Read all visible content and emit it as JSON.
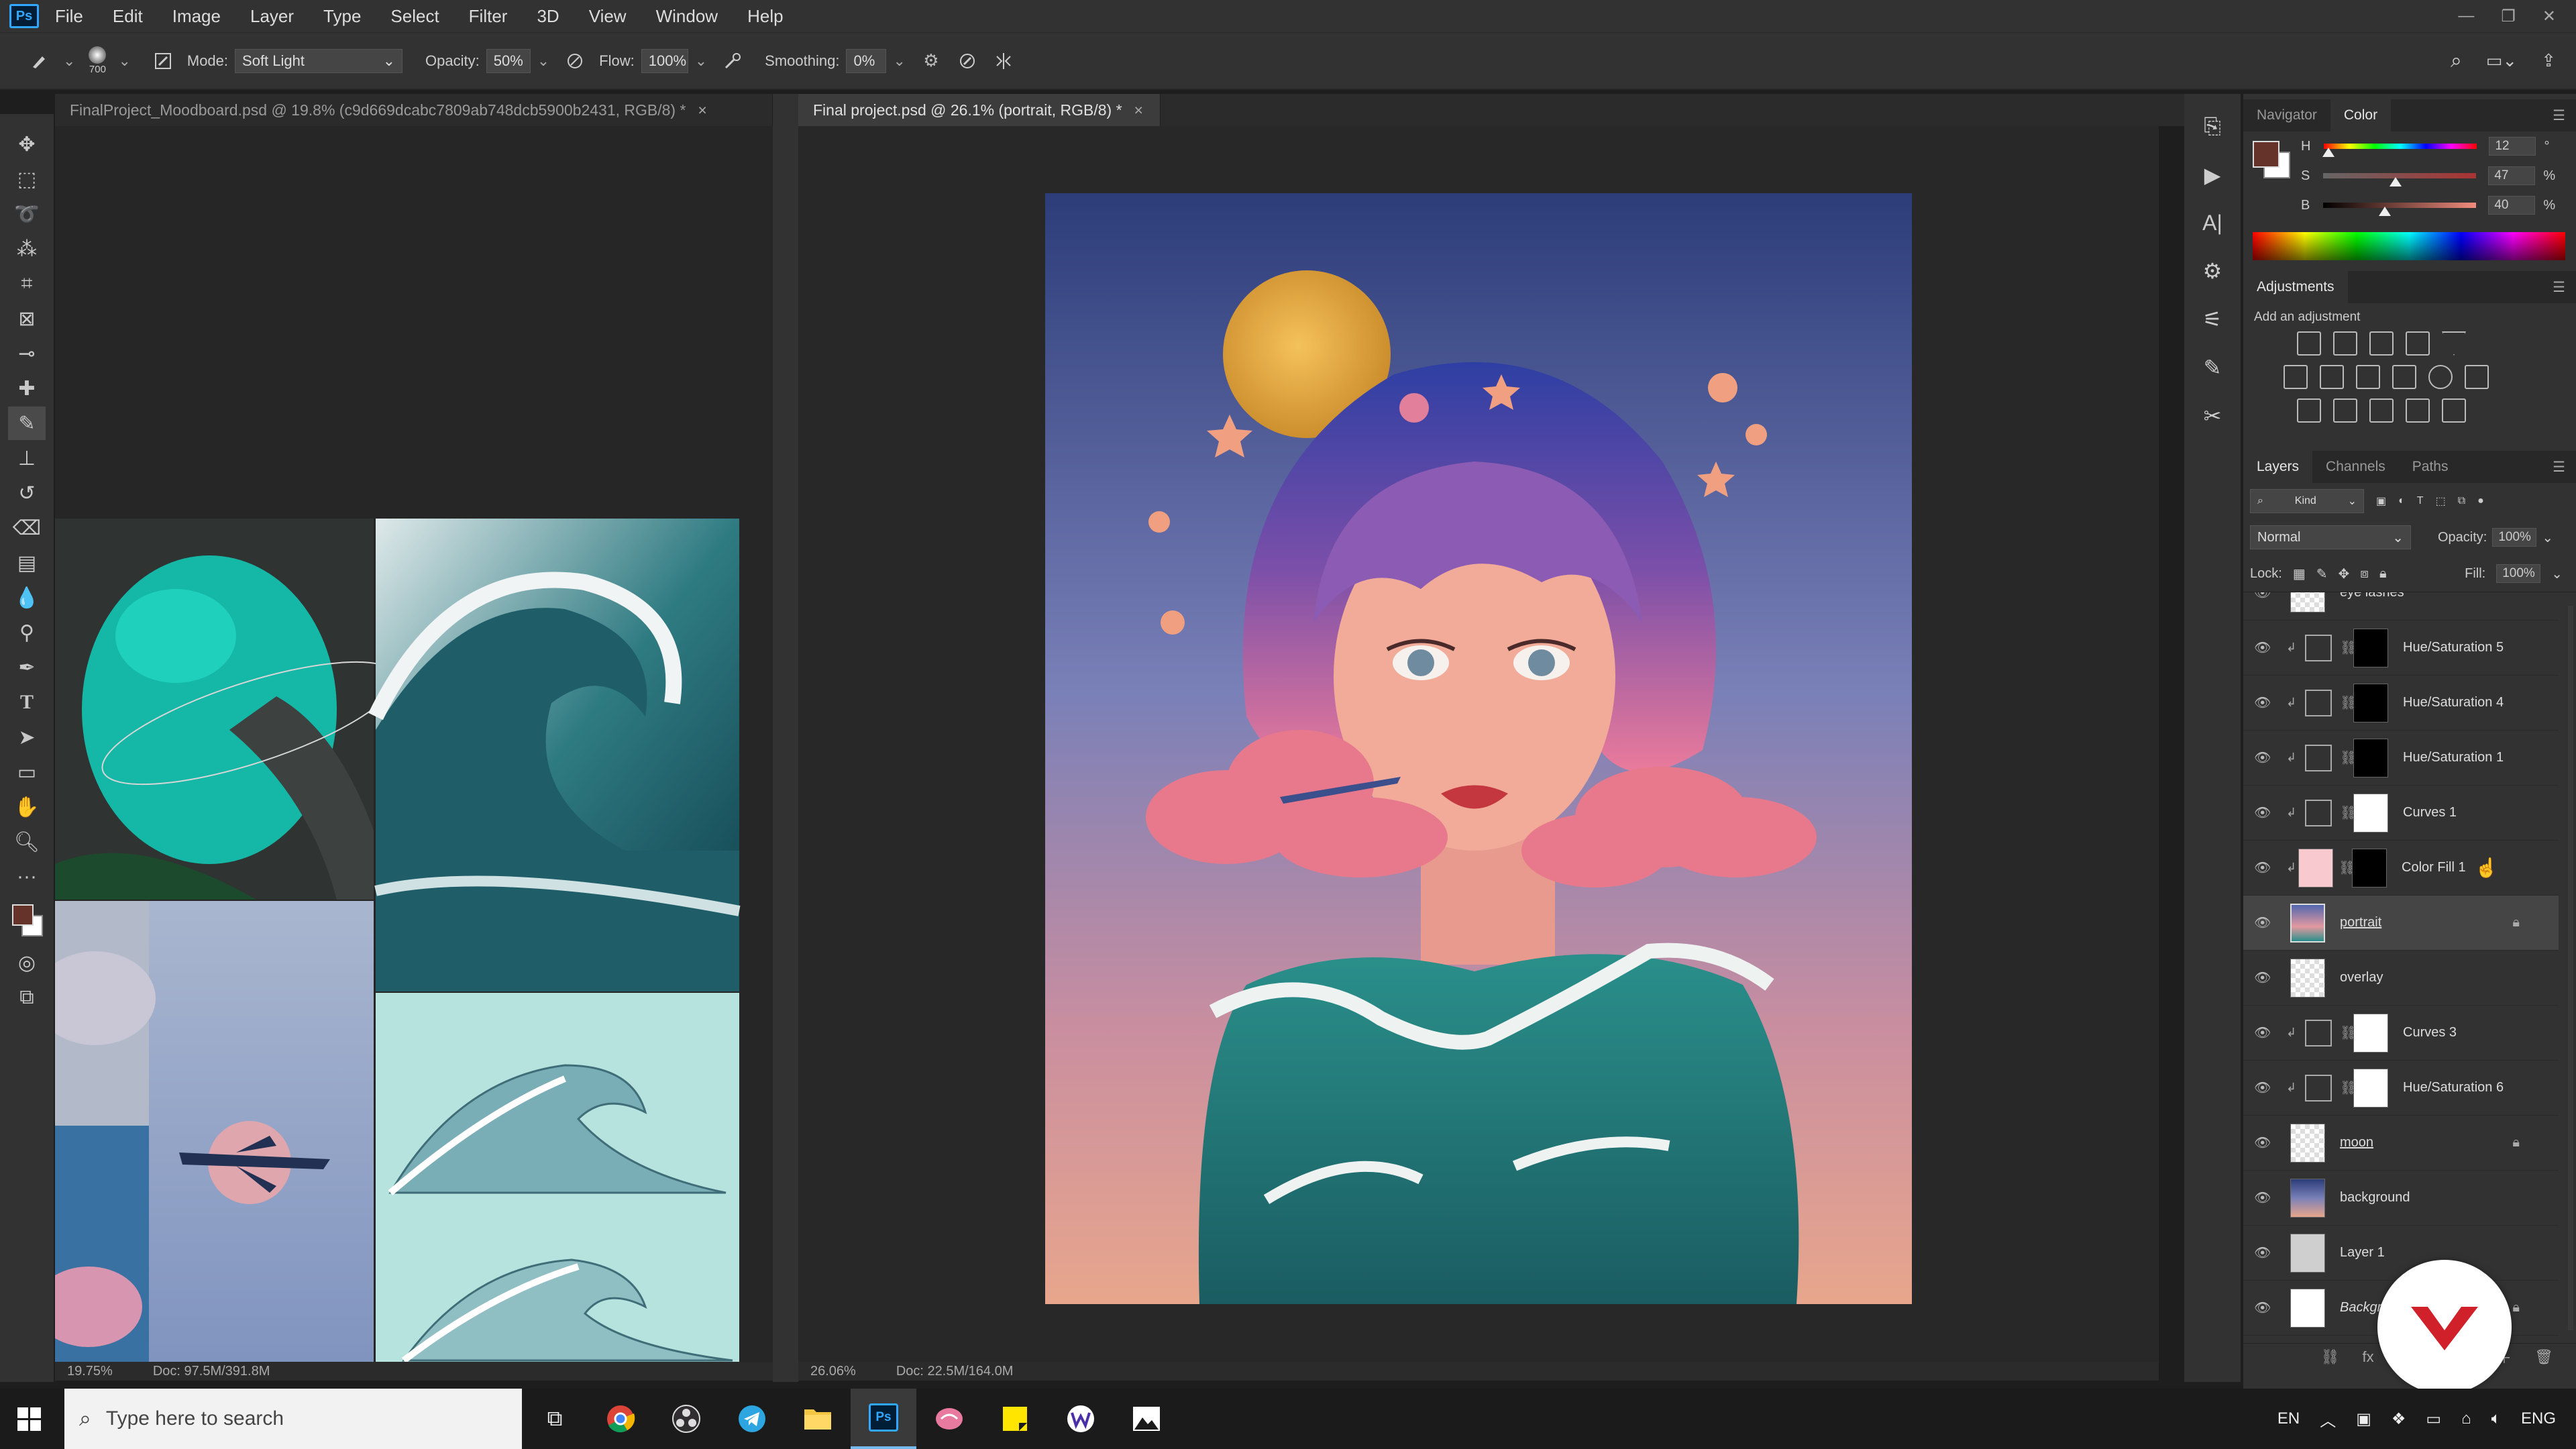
{
  "app": {
    "logo": "Ps"
  },
  "menu": [
    "File",
    "Edit",
    "Image",
    "Layer",
    "Type",
    "Select",
    "Filter",
    "3D",
    "View",
    "Window",
    "Help"
  ],
  "options": {
    "brush_size": "700",
    "mode_label": "Mode:",
    "mode_value": "Soft Light",
    "opacity_label": "Opacity:",
    "opacity_value": "50%",
    "flow_label": "Flow:",
    "flow_value": "100%",
    "smoothing_label": "Smoothing:",
    "smoothing_value": "0%"
  },
  "documents": [
    {
      "title": "FinalProject_Moodboard.psd @ 19.8% (c9d669dcabc7809ab748dcb5900b2431, RGB/8) *",
      "close": "×",
      "zoom": "19.75%",
      "doc": "Doc: 97.5M/391.8M"
    },
    {
      "title": "Final project.psd @ 26.1% (portrait, RGB/8) *",
      "close": "×",
      "zoom": "26.06%",
      "doc": "Doc: 22.5M/164.0M"
    }
  ],
  "color_panel": {
    "tabs": [
      "Navigator",
      "Color"
    ],
    "active_tab": "Color",
    "rows": [
      {
        "label": "H",
        "value": "12",
        "unit": "°",
        "level": 0.03
      },
      {
        "label": "S",
        "value": "47",
        "unit": "%",
        "level": 0.47
      },
      {
        "label": "B",
        "value": "40",
        "unit": "%",
        "level": 0.4
      }
    ],
    "foreground": "#66332b",
    "background": "#ffffff"
  },
  "adjustments": {
    "title": "Adjustments",
    "subtitle": "Add an adjustment"
  },
  "layers_panel": {
    "tabs": [
      "Layers",
      "Channels",
      "Paths"
    ],
    "filter_kind": "Kind",
    "blend_mode": "Normal",
    "opacity_label": "Opacity:",
    "opacity_value": "100%",
    "lock_label": "Lock:",
    "fill_label": "Fill:",
    "fill_value": "100%",
    "layers": [
      {
        "name": "eye lashes",
        "type": "pixel",
        "selected": false,
        "locked": false
      },
      {
        "name": "Hue/Saturation 5",
        "type": "adjustment",
        "mask": "black",
        "selected": false,
        "locked": false
      },
      {
        "name": "Hue/Saturation 4",
        "type": "adjustment",
        "mask": "black",
        "selected": false,
        "locked": false
      },
      {
        "name": "Hue/Saturation 1",
        "type": "adjustment",
        "mask": "black",
        "selected": false,
        "locked": false
      },
      {
        "name": "Curves 1",
        "type": "adjustment",
        "mask": "white",
        "selected": false,
        "locked": false
      },
      {
        "name": "Color Fill 1",
        "type": "fill",
        "mask": "black",
        "selected": false,
        "locked": false
      },
      {
        "name": "portrait",
        "type": "pixel",
        "selected": true,
        "locked": true
      },
      {
        "name": "overlay",
        "type": "pixel",
        "selected": false,
        "locked": false
      },
      {
        "name": "Curves 3",
        "type": "adjustment",
        "mask": "white",
        "selected": false,
        "locked": false
      },
      {
        "name": "Hue/Saturation 6",
        "type": "adjustment",
        "mask": "white",
        "selected": false,
        "locked": false
      },
      {
        "name": "moon",
        "type": "pixel",
        "selected": false,
        "locked": true
      },
      {
        "name": "background",
        "type": "pixel",
        "selected": false,
        "locked": false
      },
      {
        "name": "Layer 1",
        "type": "pixel",
        "selected": false,
        "locked": false
      },
      {
        "name": "Background",
        "type": "pixel",
        "selected": false,
        "locked": true
      }
    ]
  },
  "taskbar": {
    "search_placeholder": "Type here to search",
    "tray_lang": "EN",
    "tray_keyboard": "ENG"
  }
}
